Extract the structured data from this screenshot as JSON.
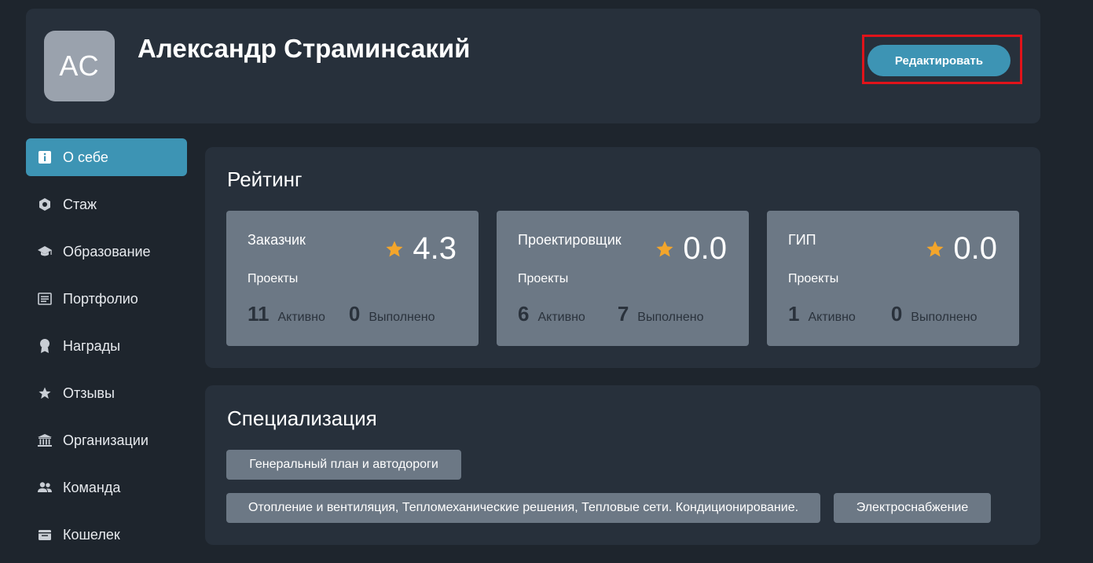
{
  "profile": {
    "initials": "АС",
    "name": "Александр Страминсакий",
    "edit_label": "Редактировать"
  },
  "sidebar": {
    "items": [
      {
        "label": "О себе",
        "icon": "info-icon",
        "active": true
      },
      {
        "label": "Стаж",
        "icon": "hexagon-icon",
        "active": false
      },
      {
        "label": "Образование",
        "icon": "graduation-cap-icon",
        "active": false
      },
      {
        "label": "Портфолио",
        "icon": "list-icon",
        "active": false
      },
      {
        "label": "Награды",
        "icon": "award-icon",
        "active": false
      },
      {
        "label": "Отзывы",
        "icon": "star-icon",
        "active": false
      },
      {
        "label": "Организации",
        "icon": "institution-icon",
        "active": false
      },
      {
        "label": "Команда",
        "icon": "team-icon",
        "active": false
      },
      {
        "label": "Кошелек",
        "icon": "wallet-icon",
        "active": false
      }
    ]
  },
  "rating": {
    "title": "Рейтинг",
    "cards": [
      {
        "role": "Заказчик",
        "score": "4.3",
        "projects_label": "Проекты",
        "active": "11",
        "active_label": "Активно",
        "done": "0",
        "done_label": "Выполнено"
      },
      {
        "role": "Проектировщик",
        "score": "0.0",
        "projects_label": "Проекты",
        "active": "6",
        "active_label": "Активно",
        "done": "7",
        "done_label": "Выполнено"
      },
      {
        "role": "ГИП",
        "score": "0.0",
        "projects_label": "Проекты",
        "active": "1",
        "active_label": "Активно",
        "done": "0",
        "done_label": "Выполнено"
      }
    ]
  },
  "specialization": {
    "title": "Специализация",
    "tags": [
      "Генеральный план и автодороги",
      "Отопление и вентиляция, Тепломеханические решения, Тепловые сети. Кондиционирование.",
      "Электроснабжение"
    ]
  },
  "colors": {
    "accent": "#3d94b4",
    "highlight_border": "#e0131a",
    "star": "#f3a52b",
    "card": "#6c7885",
    "panel": "#27303b",
    "background": "#1e252d"
  }
}
